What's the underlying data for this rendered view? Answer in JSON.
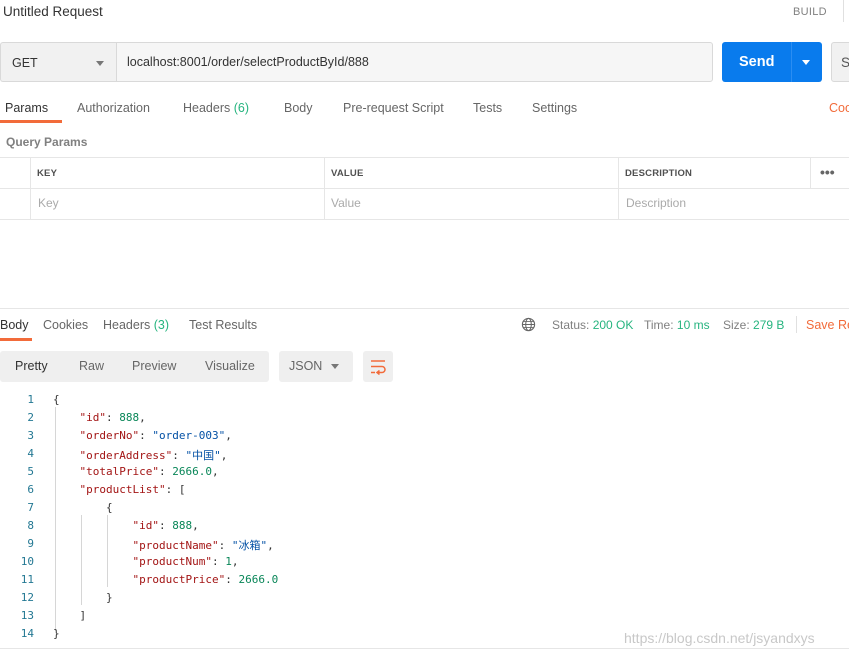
{
  "request": {
    "title": "Untitled Request",
    "build_label": "BUILD",
    "method": "GET",
    "url": "localhost:8001/order/selectProductById/888",
    "send_label": "Send",
    "save_label_partial": "S"
  },
  "request_tabs": [
    {
      "label": "Params",
      "count": ""
    },
    {
      "label": "Authorization",
      "count": ""
    },
    {
      "label": "Headers",
      "count": "(6)"
    },
    {
      "label": "Body",
      "count": ""
    },
    {
      "label": "Pre-request Script",
      "count": ""
    },
    {
      "label": "Tests",
      "count": ""
    },
    {
      "label": "Settings",
      "count": ""
    }
  ],
  "cookies_link_partial": "Coo",
  "query_params": {
    "section_label": "Query Params",
    "columns": [
      "KEY",
      "VALUE",
      "DESCRIPTION"
    ],
    "placeholders": [
      "Key",
      "Value",
      "Description"
    ],
    "more_icon": "ellipsis-icon"
  },
  "response_tabs": [
    {
      "label": "Body",
      "count": ""
    },
    {
      "label": "Cookies",
      "count": ""
    },
    {
      "label": "Headers",
      "count": "(3)"
    },
    {
      "label": "Test Results",
      "count": ""
    }
  ],
  "response_meta": {
    "globe_icon": "globe-icon",
    "status_label": "Status:",
    "status_value": "200 OK",
    "time_label": "Time:",
    "time_value": "10 ms",
    "size_label": "Size:",
    "size_value": "279 B",
    "save_response_partial": "Save Re"
  },
  "view_modes": [
    "Pretty",
    "Raw",
    "Preview",
    "Visualize"
  ],
  "format": "JSON",
  "wrap_icon": "wrap-lines-icon",
  "code_lines": [
    {
      "n": "1",
      "text": "{"
    },
    {
      "n": "2",
      "text": "    \"id\": 888,"
    },
    {
      "n": "3",
      "text": "    \"orderNo\": \"order-003\","
    },
    {
      "n": "4",
      "text": "    \"orderAddress\": \"中国\","
    },
    {
      "n": "5",
      "text": "    \"totalPrice\": 2666.0,"
    },
    {
      "n": "6",
      "text": "    \"productList\": ["
    },
    {
      "n": "7",
      "text": "        {"
    },
    {
      "n": "8",
      "text": "            \"id\": 888,"
    },
    {
      "n": "9",
      "text": "            \"productName\": \"冰箱\","
    },
    {
      "n": "10",
      "text": "            \"productNum\": 1,"
    },
    {
      "n": "11",
      "text": "            \"productPrice\": 2666.0"
    },
    {
      "n": "12",
      "text": "        }"
    },
    {
      "n": "13",
      "text": "    ]"
    },
    {
      "n": "14",
      "text": "}"
    }
  ],
  "watermark": "https://blog.csdn.net/jsyandxys",
  "colors": {
    "accent": "#f26b3a",
    "send": "#097bed",
    "success": "#26b47f"
  }
}
